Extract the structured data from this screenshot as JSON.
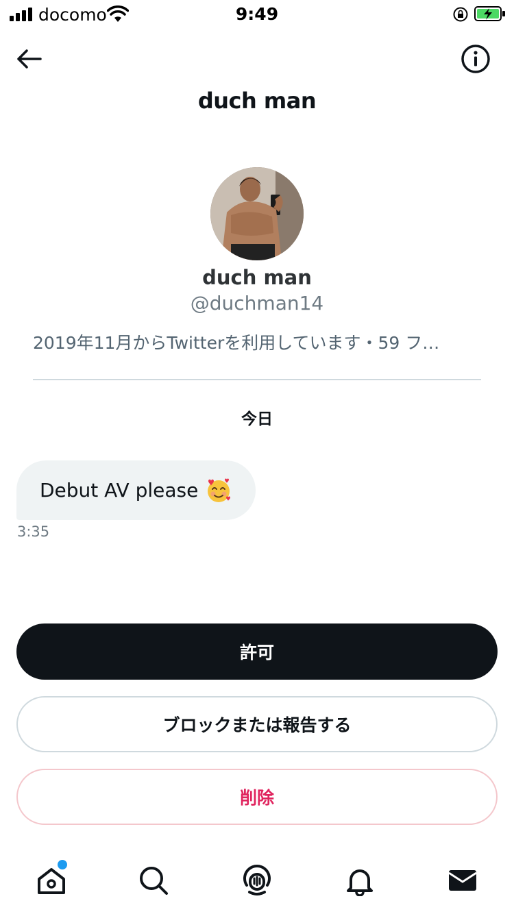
{
  "status_bar": {
    "carrier": "docomo",
    "time": "9:49"
  },
  "header": {
    "title": "duch man"
  },
  "profile": {
    "name": "duch man",
    "handle": "@duchman14",
    "meta": "2019年11月からTwitterを利用しています・59 フ…"
  },
  "conversation": {
    "date_label": "今日",
    "messages": [
      {
        "text": "Debut AV please",
        "emoji": "smiling-face-with-hearts-icon",
        "time": "3:35"
      }
    ]
  },
  "actions": {
    "allow_label": "許可",
    "block_label": "ブロックまたは報告する",
    "delete_label": "削除"
  },
  "tabbar": {
    "items": [
      "home-icon",
      "search-icon",
      "spaces-icon",
      "notifications-icon",
      "messages-icon"
    ],
    "home_has_notification": true
  },
  "colors": {
    "accent": "#1d9bf0",
    "danger": "#e0245e",
    "primary_button": "#0f1419",
    "bubble_bg": "#eff3f4",
    "battery_green": "#4cd964"
  }
}
